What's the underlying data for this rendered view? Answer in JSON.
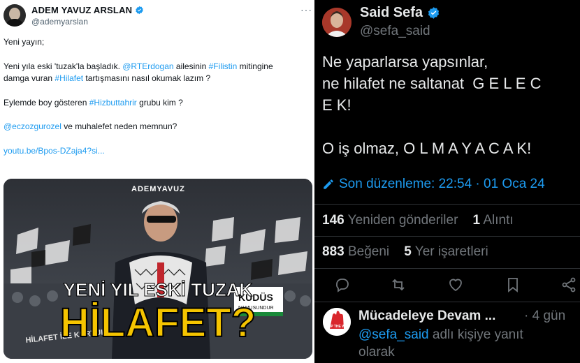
{
  "left_tweet": {
    "author_name": "ADEM YAVUZ ARSLAN",
    "author_handle": "@ademyarslan",
    "more_label": "···",
    "line1": "Yeni yayın;",
    "p2_a": "Yeni yıla eski 'tuzak'la başladık. ",
    "p2_mention": "@RTErdogan",
    "p2_b": " ailesinin ",
    "p2_tag1": "#Filistin",
    "p2_c": " mitingine",
    "p2_d": "damga vuran ",
    "p2_tag2": "#Hilafet",
    "p2_e": " tartışmasını nasıl okumak lazım ?",
    "p3_a": "Eylemde boy gösteren ",
    "p3_tag": "#Hizbuttahrir",
    "p3_b": " grubu kim ?",
    "p4_mention": "@eczozgurozel",
    "p4_b": " ve muhalefet neden memnun?",
    "link": "youtu.be/Bpos-DZaja4?si...",
    "media": {
      "brand": "ADEMYAVUZ",
      "headline1": "YENİ YIL ESKİ TUZAK",
      "headline2": "HİLAFET?",
      "banner": "KUDÜS",
      "banner_sub": "NAMUSUNDUR",
      "crowd_sign": "HİLAFET İLE KURTUL"
    }
  },
  "right_tweet": {
    "author_name": "Said Sefa",
    "author_handle": "@sefa_said",
    "line1": "Ne yaparlarsa yapsınlar,",
    "line2": "ne hilafet ne saltanat  G E L E C",
    "line3": "E K!",
    "line4": "O iş olmaz, O L M A Y A C A K!",
    "edit_label": "Son düzenleme: 22:54 · 01 Oca 24",
    "retweets_count": "146",
    "retweets_label": "Yeniden gönderiler",
    "quotes_count": "1",
    "quotes_label": "Alıntı",
    "likes_count": "883",
    "likes_label": "Beğeni",
    "bookmarks_count": "5",
    "bookmarks_label": "Yer işaretleri",
    "reply": {
      "author_name": "Mücadeleye Devam ...",
      "time": "· 4 gün",
      "mention": "@sefa_said",
      "text_a": " adlı kişiye yanıt",
      "text_b": "olarak",
      "avatar_text": "STOP THE WAR"
    }
  },
  "colors": {
    "link_blue": "#1d9bf0",
    "verified_blue": "#1d9bf0",
    "headline_yellow": "#f5c400",
    "dark_bg": "#000000",
    "muted": "#71767b"
  }
}
